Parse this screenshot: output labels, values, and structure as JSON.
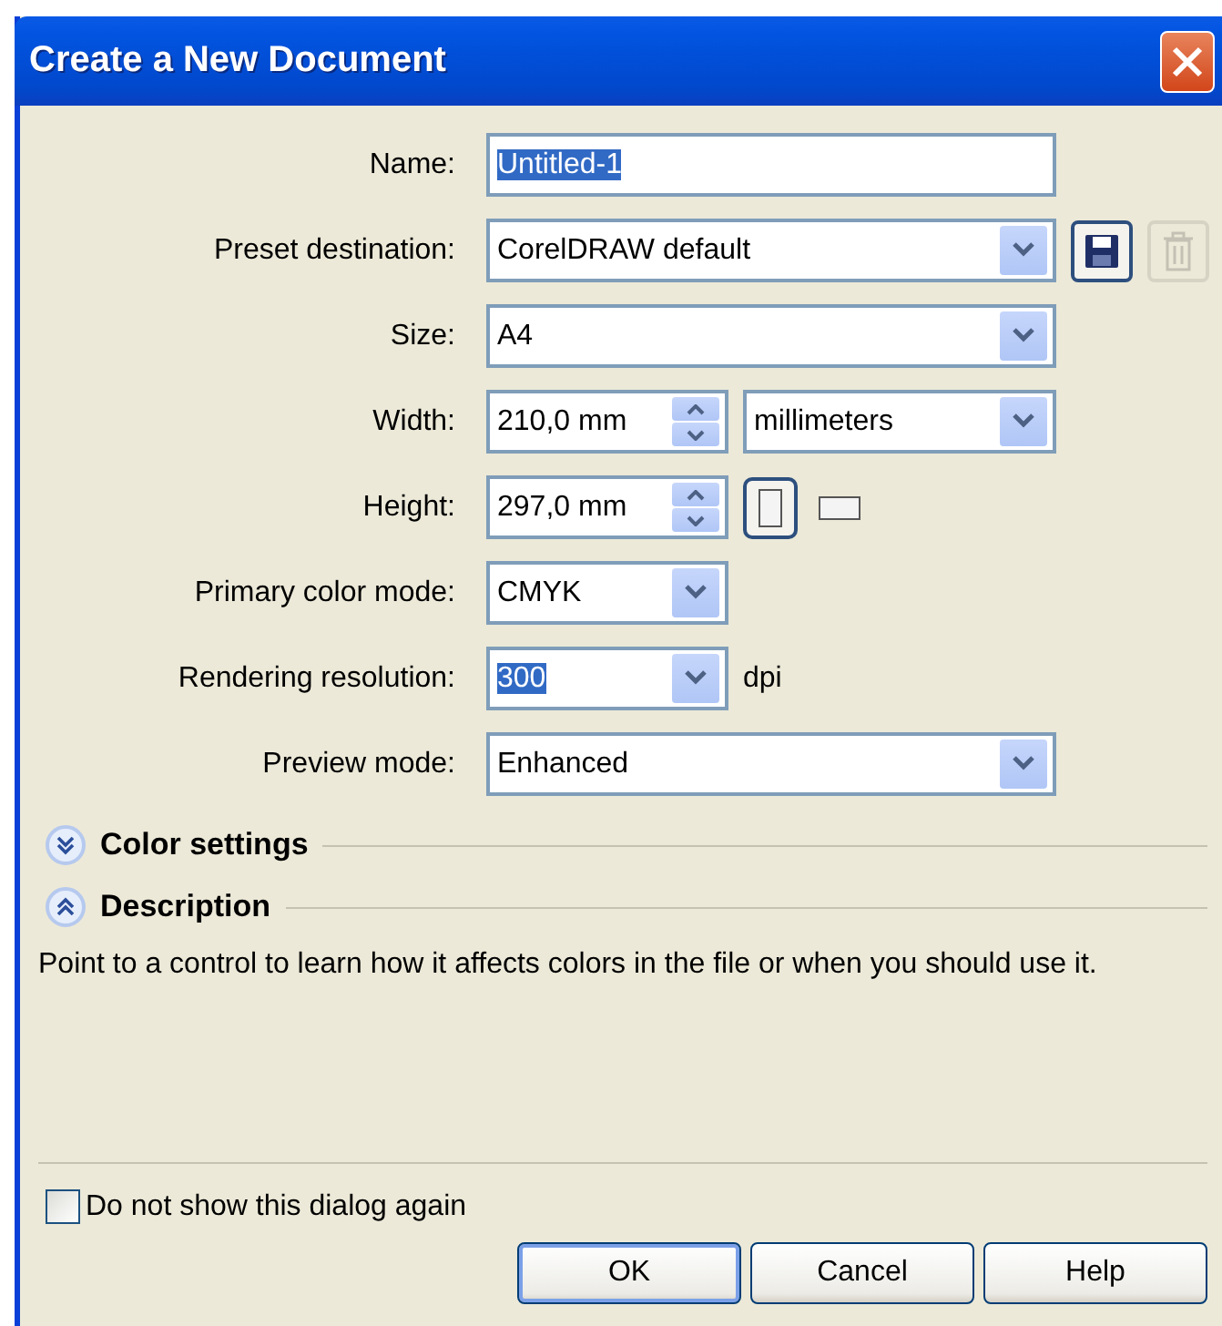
{
  "window": {
    "title": "Create a New Document"
  },
  "fields": [
    {
      "label": "Name:",
      "kind": "text",
      "value": "Untitled-1",
      "highlighted": true
    },
    {
      "label": "Preset destination:",
      "kind": "combo",
      "value": "CorelDRAW default",
      "highlighted": false,
      "actions": [
        {
          "kind": "save",
          "disabled": false
        },
        {
          "kind": "delete",
          "disabled": true
        }
      ]
    },
    {
      "label": "Size:",
      "kind": "combo",
      "value": "A4",
      "highlighted": false
    },
    {
      "label": "Width:",
      "kind": "spin",
      "value": "210,0 mm",
      "highlighted": false,
      "unit": "millimeters"
    },
    {
      "label": "Height:",
      "kind": "spin",
      "value": "297,0 mm",
      "highlighted": false,
      "orientations": [
        {
          "kind": "portrait",
          "selected": true
        },
        {
          "kind": "landscape",
          "selected": false
        }
      ]
    },
    {
      "label": "Primary color mode:",
      "kind": "short-combo",
      "value": "CMYK",
      "highlighted": false
    },
    {
      "label": "Rendering resolution:",
      "kind": "short-combo",
      "value": "300",
      "highlighted": true,
      "suffix": "dpi"
    },
    {
      "label": "Preview mode:",
      "kind": "combo",
      "value": "Enhanced",
      "highlighted": false
    }
  ],
  "sections": [
    {
      "title": "Color settings",
      "expanded": false
    },
    {
      "title": "Description",
      "expanded": true
    }
  ],
  "description": "Point to a control to learn how it affects colors in the file or when you should use it.",
  "checkbox": {
    "label": "Do not show this dialog again",
    "checked": false
  },
  "buttons": [
    {
      "label": "OK",
      "default": true
    },
    {
      "label": "Cancel",
      "default": false
    },
    {
      "label": "Help",
      "default": false
    }
  ]
}
